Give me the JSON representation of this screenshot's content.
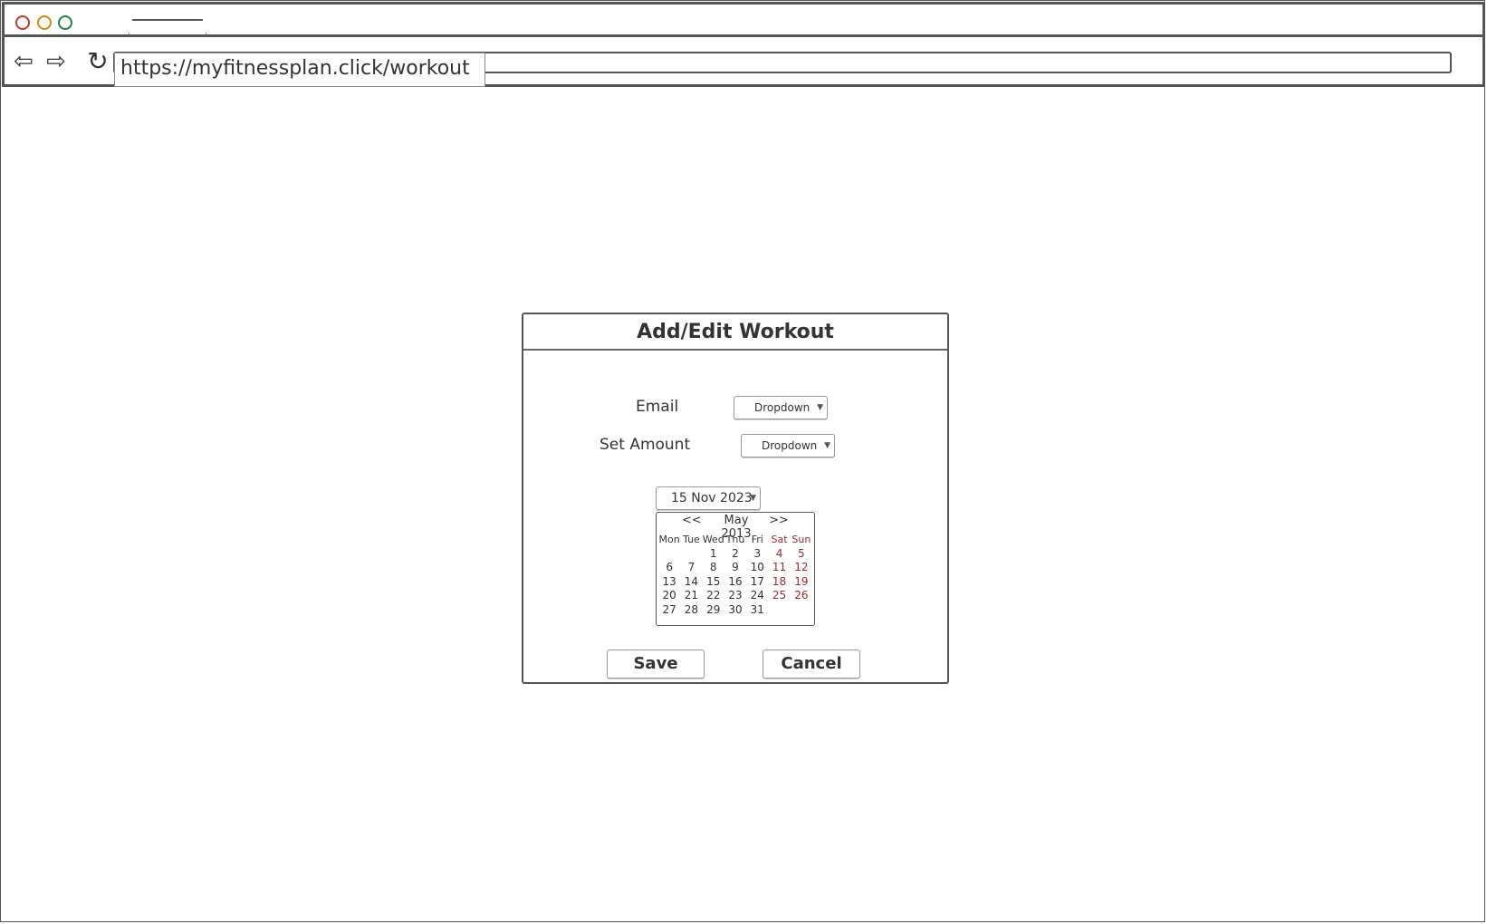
{
  "browser": {
    "url": "https://myfitnessplan.click/workout"
  },
  "dialog": {
    "title": "Add/Edit Workout",
    "email_label": "Email",
    "email_dropdown": "Dropdown",
    "set_amount_label": "Set Amount",
    "set_amount_dropdown": "Dropdown",
    "date_value": "15 Nov 2023",
    "calendar": {
      "prev": "<<",
      "title": "May 2013",
      "next": ">>",
      "weekdays": [
        "Mon",
        "Tue",
        "Wed",
        "Thu",
        "Fri",
        "Sat",
        "Sun"
      ],
      "weeks": [
        [
          "",
          "",
          "1",
          "2",
          "3",
          "4",
          "5"
        ],
        [
          "6",
          "7",
          "8",
          "9",
          "10",
          "11",
          "12"
        ],
        [
          "13",
          "14",
          "15",
          "16",
          "17",
          "18",
          "19"
        ],
        [
          "20",
          "21",
          "22",
          "23",
          "24",
          "25",
          "26"
        ],
        [
          "27",
          "28",
          "29",
          "30",
          "31",
          "",
          ""
        ]
      ]
    },
    "save_label": "Save",
    "cancel_label": "Cancel"
  },
  "colors": {
    "weekend": "#a0292b",
    "border": "#555555"
  }
}
